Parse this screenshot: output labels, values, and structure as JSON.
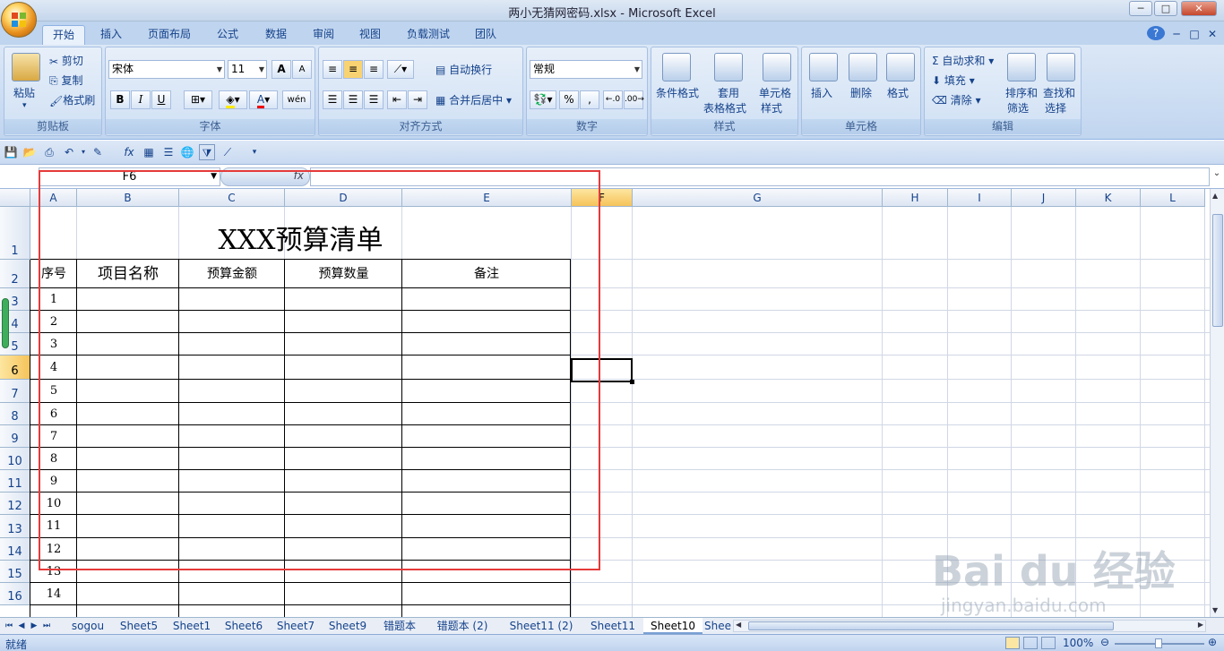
{
  "window": {
    "title": "两小无猜网密码.xlsx - Microsoft Excel",
    "btn_min": "─",
    "btn_max": "□",
    "btn_close": "✕"
  },
  "ribbon_tabs": [
    "开始",
    "插入",
    "页面布局",
    "公式",
    "数据",
    "审阅",
    "视图",
    "负载测试",
    "团队"
  ],
  "help_icons": [
    "?",
    "─",
    "□",
    "✕"
  ],
  "clipboard": {
    "paste": "粘贴",
    "cut": "剪切",
    "copy": "复制",
    "format_painter": "格式刷",
    "label": "剪贴板"
  },
  "font": {
    "name": "宋体",
    "size": "11",
    "grow": "A",
    "shrink": "A",
    "bold": "B",
    "italic": "I",
    "underline": "U",
    "phonetic": "wén",
    "label": "字体"
  },
  "alignment": {
    "wrap": "自动换行",
    "merge": "合并后居中",
    "label": "对齐方式"
  },
  "number": {
    "format": "常规",
    "percent": "%",
    "comma": ",",
    "label": "数字"
  },
  "styles": {
    "cond": "条件格式",
    "table1": "套用",
    "table2": "表格格式",
    "cell1": "单元格",
    "cell2": "样式",
    "label": "样式"
  },
  "cells": {
    "insert": "插入",
    "delete": "删除",
    "format": "格式",
    "label": "单元格"
  },
  "editing": {
    "sum": "自动求和",
    "fill": "填充",
    "clear": "清除",
    "sort1": "排序和",
    "sort2": "筛选",
    "find1": "查找和",
    "find2": "选择",
    "label": "编辑"
  },
  "formula": {
    "name_box": "F6",
    "fx": "fx",
    "value": ""
  },
  "columns": [
    "A",
    "B",
    "C",
    "D",
    "E",
    "F",
    "G",
    "H",
    "I",
    "J",
    "K",
    "L"
  ],
  "rows": [
    "1",
    "2",
    "3",
    "4",
    "5",
    "6",
    "7",
    "8",
    "9",
    "10",
    "11",
    "12",
    "13",
    "14",
    "15",
    "16"
  ],
  "selected_cell": {
    "col": "F",
    "row": "6"
  },
  "sheet_content": {
    "title": "XXX预算清单",
    "headers": [
      "序号",
      "项目名称",
      "预算金额",
      "预算数量",
      "备注"
    ],
    "serials": [
      "1",
      "2",
      "3",
      "4",
      "5",
      "6",
      "7",
      "8",
      "9",
      "10",
      "11",
      "12",
      "13",
      "14"
    ]
  },
  "sheet_tabs": [
    "sogou",
    "Sheet5",
    "Sheet1",
    "Sheet6",
    "Sheet7",
    "Sheet9",
    "错题本",
    "错题本 (2)",
    "Sheet11 (2)",
    "Sheet11",
    "Sheet10",
    "Shee"
  ],
  "active_sheet": "Sheet10",
  "status": {
    "ready": "就绪",
    "zoom": "100%"
  },
  "watermark": {
    "logo": "Bai  du 经验",
    "url": "jingyan.baidu.com"
  },
  "colors": {
    "accent": "#15428b",
    "highlight": "#e53a3a",
    "selected_header": "#f6c35a"
  }
}
